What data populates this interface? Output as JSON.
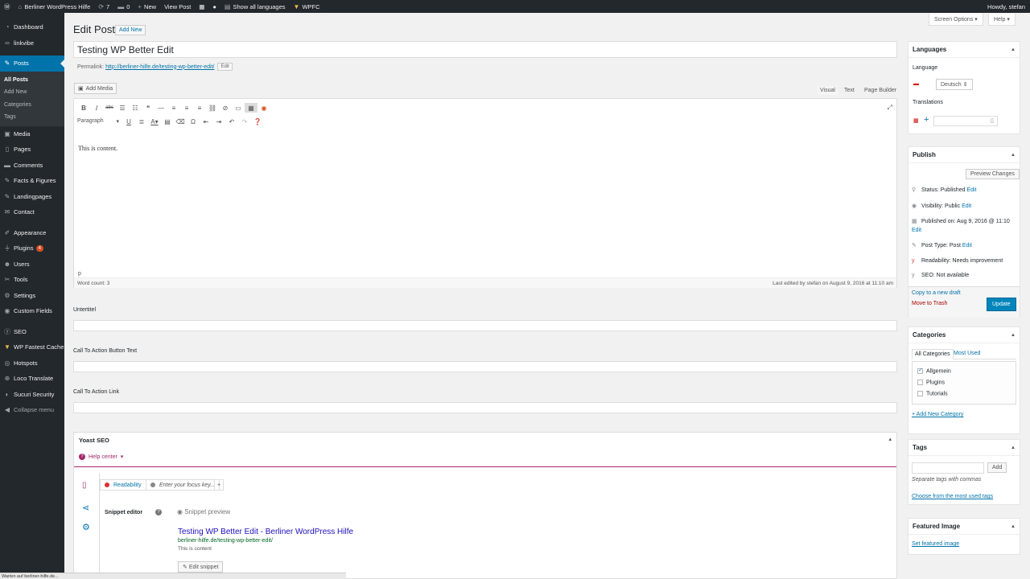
{
  "adminbar": {
    "site_name": "Berliner WordPress Hilfe",
    "updates_count": "7",
    "comments_count": "0",
    "new_label": "New",
    "view_post": "View Post",
    "languages": "Show all languages",
    "wpfc": "WPFC",
    "howdy": "Howdy, stefan"
  },
  "sidebar": {
    "items": [
      {
        "label": "Dashboard",
        "icon": "dashboard-icon"
      },
      {
        "label": "linkvibe",
        "icon": "linkvibe-icon"
      },
      {
        "label": "Posts",
        "icon": "pin-icon"
      },
      {
        "label": "Media",
        "icon": "media-icon"
      },
      {
        "label": "Pages",
        "icon": "pages-icon"
      },
      {
        "label": "Comments",
        "icon": "comments-icon"
      },
      {
        "label": "Facts & Figures",
        "icon": "pin-icon"
      },
      {
        "label": "Landingpages",
        "icon": "pin-icon"
      },
      {
        "label": "Contact",
        "icon": "mail-icon"
      },
      {
        "label": "Appearance",
        "icon": "brush-icon"
      },
      {
        "label": "Plugins",
        "icon": "plugin-icon",
        "badge": "4"
      },
      {
        "label": "Users",
        "icon": "users-icon"
      },
      {
        "label": "Tools",
        "icon": "tools-icon"
      },
      {
        "label": "Settings",
        "icon": "settings-icon"
      },
      {
        "label": "Custom Fields",
        "icon": "custom-fields-icon"
      },
      {
        "label": "SEO",
        "icon": "yoast-icon"
      },
      {
        "label": "WP Fastest Cache",
        "icon": "cache-icon"
      },
      {
        "label": "Hotspots",
        "icon": "hotspots-icon"
      },
      {
        "label": "Loco Translate",
        "icon": "translate-icon"
      },
      {
        "label": "Sucuri Security",
        "icon": "security-icon"
      },
      {
        "label": "Collapse menu",
        "icon": "collapse-icon"
      }
    ],
    "posts_sub": [
      "All Posts",
      "Add New",
      "Categories",
      "Tags"
    ]
  },
  "screen_options": "Screen Options",
  "help": "Help",
  "page": {
    "title": "Edit Post",
    "add_new": "Add New",
    "post_title": "Testing WP Better Edit",
    "permalink_label": "Permalink:",
    "permalink_url": "http://berliner-hilfe.de/testing-wp-better-edit/",
    "permalink_edit": "Edit",
    "add_media": "Add Media",
    "tabs": [
      "Visual",
      "Text",
      "Page Builder"
    ]
  },
  "editor": {
    "format": "Paragraph",
    "content": "This is content.",
    "path": "p",
    "word_count": "Word count: 3",
    "last_edited": "Last edited by stefan on August 9, 2016 at 11:10 am"
  },
  "custom_fields": [
    "Untertitel",
    "Call To Action Button Text",
    "Call To Action Link"
  ],
  "yoast": {
    "title": "Yoast SEO",
    "help_center": "Help center",
    "readability": "Readability",
    "focus_placeholder": "Enter your focus key...",
    "add_tab": "+",
    "snippet_editor": "Snippet editor",
    "snippet_preview": "Snippet preview",
    "sn_title": "Testing WP Better Edit - Berliner WordPress Hilfe",
    "sn_url": "berliner-hilfe.de/testing-wp-better-edit/",
    "sn_desc": "This is content",
    "edit_snippet": "Edit snippet"
  },
  "languages_box": {
    "title": "Languages",
    "language_label": "Language",
    "language_value": "Deutsch",
    "translations_label": "Translations"
  },
  "publish": {
    "title": "Publish",
    "preview": "Preview Changes",
    "status": "Status: Published",
    "visibility": "Visibility: Public",
    "published_on": "Published on: Aug 9, 2016 @ 11:10",
    "post_type": "Post Type: Post",
    "readability": "Readability: Needs improvement",
    "seo": "SEO: Not available",
    "edit": "Edit",
    "copy_draft": "Copy to a new draft",
    "trash": "Move to Trash",
    "update": "Update"
  },
  "categories": {
    "title": "Categories",
    "tab_all": "All Categories",
    "tab_most": "Most Used",
    "items": [
      {
        "label": "Allgemein",
        "checked": true
      },
      {
        "label": "Plugins",
        "checked": false
      },
      {
        "label": "Tutorials",
        "checked": false
      }
    ],
    "add_new": "+ Add New Category"
  },
  "tags": {
    "title": "Tags",
    "add": "Add",
    "hint": "Separate tags with commas",
    "choose": "Choose from the most used tags"
  },
  "featured": {
    "title": "Featured Image",
    "set": "Set featured image"
  },
  "statusbar": "Warten auf berliner-hilfe.de..."
}
